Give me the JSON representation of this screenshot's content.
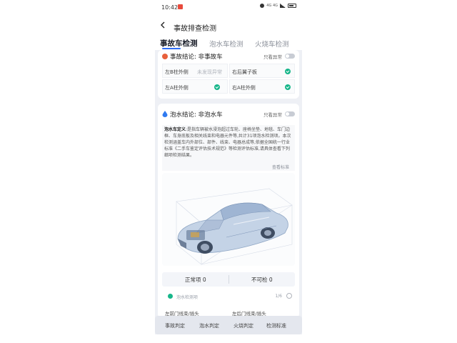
{
  "status_bar": {
    "time": "10:42",
    "network_label": "4G 4G"
  },
  "header": {
    "title": "事故排查检测"
  },
  "tabs": [
    {
      "label": "事故车检测",
      "active": true
    },
    {
      "label": "泡水车检测",
      "active": false
    },
    {
      "label": "火烧车检测",
      "active": false
    }
  ],
  "accident": {
    "conclusion_prefix": "事故结论:",
    "conclusion_value": "非事故车",
    "abnormal_only_label": "只看异常",
    "items": [
      {
        "label": "左B柱外侧",
        "value": "未发现异常",
        "ok": false
      },
      {
        "label": "右后翼子板",
        "value": "",
        "ok": true
      },
      {
        "label": "左A柱外侧",
        "value": "",
        "ok": true
      },
      {
        "label": "右A柱外侧",
        "value": "",
        "ok": true
      }
    ]
  },
  "flood": {
    "conclusion_prefix": "泡水结论:",
    "conclusion_value": "非泡水车",
    "abnormal_only_label": "只看异常",
    "desc_title": "泡水车定义",
    "desc_body": ":是指车辆被水浸泡超过车轮、座椅坐垫、地毯、车门边框、车身底板及相关线束和电器元件等,共计31项泡水检测项。本次检测涵盖车内外部位、部件、线束、电器总成等,依据全国统一行业标准《二手车鉴定评估技术规范》等检测评估标准,请具体查看下列细项检测结果。",
    "more_label": "查看标准",
    "stats_normal": "正常项 0",
    "stats_unchecked": "不可检 0",
    "row_text": "泡水检测项",
    "row_page": "1/6",
    "bottom_left": "左前门线束/插头",
    "bottom_right": "左后门线束/插头"
  },
  "bottom_nav": [
    {
      "label": "事故判定"
    },
    {
      "label": "泡水判定"
    },
    {
      "label": "火烧判定"
    },
    {
      "label": "检测标准"
    }
  ],
  "colors": {
    "accent": "#2e6df6",
    "ok": "#17b68a",
    "accident_icon": "#e8603c",
    "flood_icon": "#2f7af0"
  }
}
